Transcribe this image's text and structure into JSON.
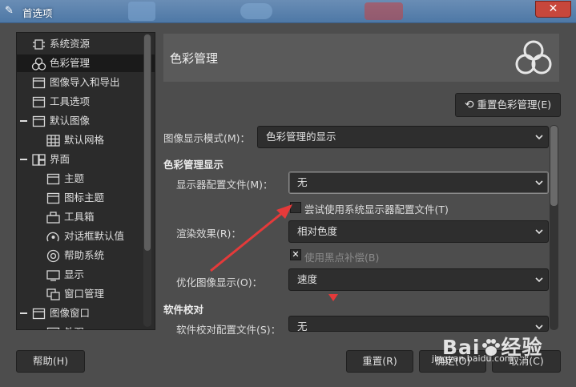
{
  "window": {
    "title": "首选项",
    "close_glyph": "✕"
  },
  "sidebar": {
    "items": [
      {
        "label": "系统资源",
        "icon": "chip-icon",
        "indent": 0
      },
      {
        "label": "色彩管理",
        "icon": "color-circles-icon",
        "indent": 0,
        "selected": true
      },
      {
        "label": "图像导入和导出",
        "icon": "import-export-icon",
        "indent": 0
      },
      {
        "label": "工具选项",
        "icon": "tool-options-icon",
        "indent": 0
      },
      {
        "label": "默认图像",
        "icon": "default-image-icon",
        "indent": 0,
        "expander": true
      },
      {
        "label": "默认网格",
        "icon": "grid-icon",
        "indent": 1
      },
      {
        "label": "界面",
        "icon": "interface-icon",
        "indent": 0,
        "expander": true
      },
      {
        "label": "主题",
        "icon": "theme-icon",
        "indent": 1
      },
      {
        "label": "图标主题",
        "icon": "icon-theme-icon",
        "indent": 1
      },
      {
        "label": "工具箱",
        "icon": "toolbox-icon",
        "indent": 1
      },
      {
        "label": "对话框默认值",
        "icon": "dialog-defaults-icon",
        "indent": 1
      },
      {
        "label": "帮助系统",
        "icon": "help-system-icon",
        "indent": 1
      },
      {
        "label": "显示",
        "icon": "display-icon",
        "indent": 1
      },
      {
        "label": "窗口管理",
        "icon": "window-management-icon",
        "indent": 1
      },
      {
        "label": "图像窗口",
        "icon": "image-window-icon",
        "indent": 0,
        "expander": true
      },
      {
        "label": "外观",
        "icon": "appearance-icon",
        "indent": 1
      }
    ]
  },
  "main": {
    "page_title": "色彩管理",
    "reset_button": "重置色彩管理(E)",
    "display_mode_label": "图像显示模式(M)：",
    "display_mode_value": "色彩管理的显示",
    "section_display": "色彩管理显示",
    "monitor_profile_label": "显示器配置文件(M)：",
    "monitor_profile_value": "无",
    "try_system_profile": {
      "label": "尝试使用系统显示器配置文件(T)",
      "checked": false
    },
    "rendering_intent_label": "渲染效果(R)：",
    "rendering_intent_value": "相对色度",
    "black_point": {
      "label": "使用黑点补偿(B)",
      "checked": true
    },
    "optimize_label": "优化图像显示(O)：",
    "optimize_value": "速度",
    "section_softproof": "软件校对",
    "softproof_profile_label": "软件校对配置文件(S)：",
    "softproof_profile_value": "无"
  },
  "footer": {
    "help_button": "帮助(H)",
    "reset_button": "重置(R)",
    "ok_button": "确定(O)",
    "cancel_button": "取消(C)"
  },
  "watermark": {
    "brand": "Bai",
    "brand2": "经验",
    "url": "jingyan.baidu.com"
  },
  "colors": {
    "accent_red": "#e53a3a",
    "panel": "#4d4d4d",
    "titlebar": "#5a82ad"
  }
}
